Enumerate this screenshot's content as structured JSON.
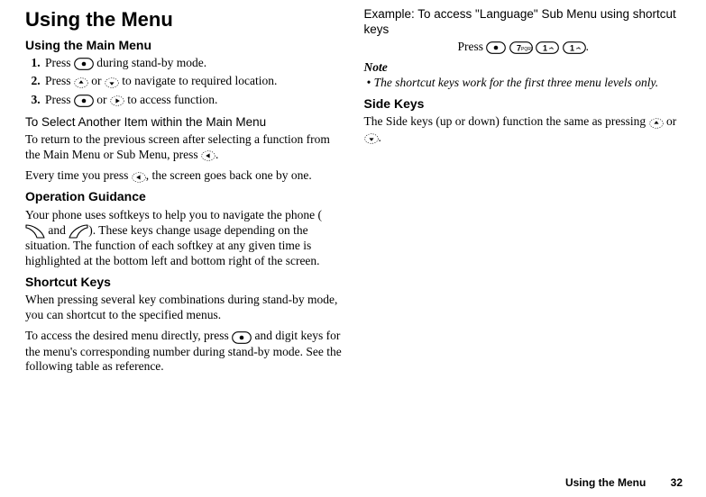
{
  "title": "Using the Menu",
  "left": {
    "h2a": "Using the Main Menu",
    "steps": [
      {
        "pre": "Press ",
        "post": " during stand-by mode."
      },
      {
        "pre": "Press ",
        "mid": " or ",
        "post": " to navigate to required location."
      },
      {
        "pre": "Press ",
        "mid": " or ",
        "post": " to access function."
      }
    ],
    "h3a": "To Select Another Item within the Main Menu",
    "p1a": "To return to the previous screen after selecting a function from the Main Menu or Sub Menu, press ",
    "p1b": ".",
    "p2a": "Every time you press ",
    "p2b": ", the screen goes back one by one.",
    "h2b": "Operation Guidance",
    "p3a": "Your phone uses softkeys to help you to navigate the phone (",
    "p3b": " and ",
    "p3c": "). These keys change usage depending on the situation. The function of each softkey at any given time is highlighted at the bottom left and bottom right of the screen.",
    "h2c": "Shortcut Keys",
    "p4": "When pressing several key combinations during stand-by mode, you can shortcut to the specified menus.",
    "p5a": "To access the desired menu directly, press ",
    "p5b": " and digit keys for the menu's corresponding number during stand-by mode. See the following table as reference."
  },
  "right": {
    "exampleHead": "Example: To access \"Language\" Sub Menu using shortcut keys",
    "press": "Press ",
    "pressEnd": ".",
    "noteHead": "Note",
    "noteBullet": "•",
    "noteBody": "The shortcut keys work for the first three menu levels only.",
    "h2d": "Side Keys",
    "p6a": "The Side keys (up or down) function the same as pressing ",
    "p6b": " or ",
    "p6c": "."
  },
  "footer": {
    "title": "Using the Menu",
    "pageno": "32"
  }
}
